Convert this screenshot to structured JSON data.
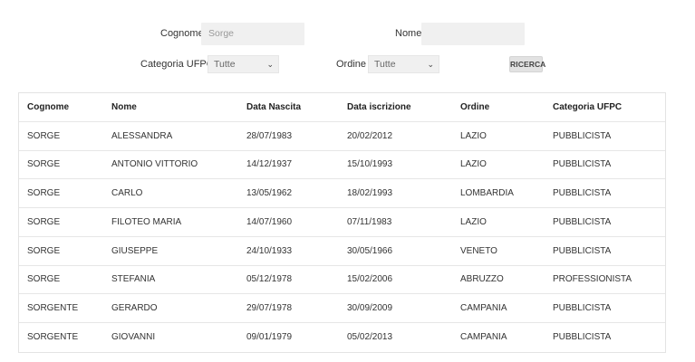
{
  "form": {
    "cognome_label": "Cognome",
    "cognome_value": "Sorge",
    "nome_label": "Nome",
    "nome_value": "",
    "categoria_label": "Categoria UFPC",
    "categoria_selected": "Tutte",
    "ordine_label": "Ordine",
    "ordine_selected": "Tutte",
    "search_button": "RICERCA"
  },
  "table": {
    "headers": [
      "Cognome",
      "Nome",
      "Data Nascita",
      "Data iscrizione",
      "Ordine",
      "Categoria UFPC"
    ],
    "rows": [
      [
        "SORGE",
        "ALESSANDRA",
        "28/07/1983",
        "20/02/2012",
        "LAZIO",
        "PUBBLICISTA"
      ],
      [
        "SORGE",
        "ANTONIO VITTORIO",
        "14/12/1937",
        "15/10/1993",
        "LAZIO",
        "PUBBLICISTA"
      ],
      [
        "SORGE",
        "CARLO",
        "13/05/1962",
        "18/02/1993",
        "LOMBARDIA",
        "PUBBLICISTA"
      ],
      [
        "SORGE",
        "FILOTEO MARIA",
        "14/07/1960",
        "07/11/1983",
        "LAZIO",
        "PUBBLICISTA"
      ],
      [
        "SORGE",
        "GIUSEPPE",
        "24/10/1933",
        "30/05/1966",
        "VENETO",
        "PUBBLICISTA"
      ],
      [
        "SORGE",
        "STEFANIA",
        "05/12/1978",
        "15/02/2006",
        "ABRUZZO",
        "PROFESSIONISTA"
      ],
      [
        "SORGENTE",
        "GERARDO",
        "29/07/1978",
        "30/09/2009",
        "CAMPANIA",
        "PUBBLICISTA"
      ],
      [
        "SORGENTE",
        "GIOVANNI",
        "09/01/1979",
        "05/02/2013",
        "CAMPANIA",
        "PUBBLICISTA"
      ]
    ]
  }
}
